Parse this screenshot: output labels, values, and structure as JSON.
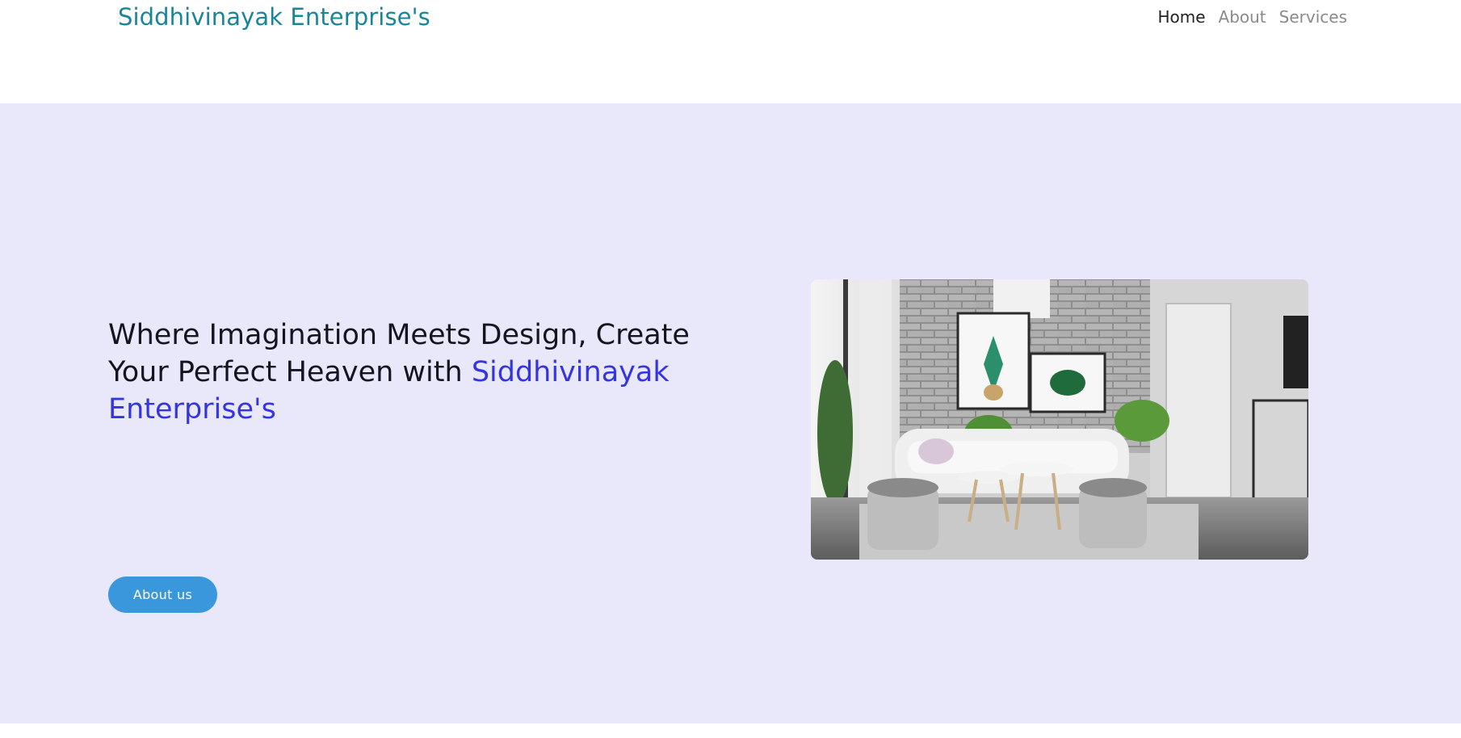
{
  "brand": {
    "name": "Siddhivinayak Enterprise's"
  },
  "nav": {
    "items": [
      {
        "label": "Home",
        "active": true
      },
      {
        "label": "About",
        "active": false
      },
      {
        "label": "Services",
        "active": false
      }
    ]
  },
  "hero": {
    "headline_prefix": "Where Imagination Meets Design, Create Your Perfect Heaven with ",
    "headline_accent": "Siddhivinayak Enterprise's",
    "cta_label": "About us",
    "image_alt": "living-room-interior"
  },
  "colors": {
    "brand": "#1a8596",
    "accent": "#3434e0",
    "hero_bg": "#e9e8fb",
    "button": "#3a97dc"
  }
}
